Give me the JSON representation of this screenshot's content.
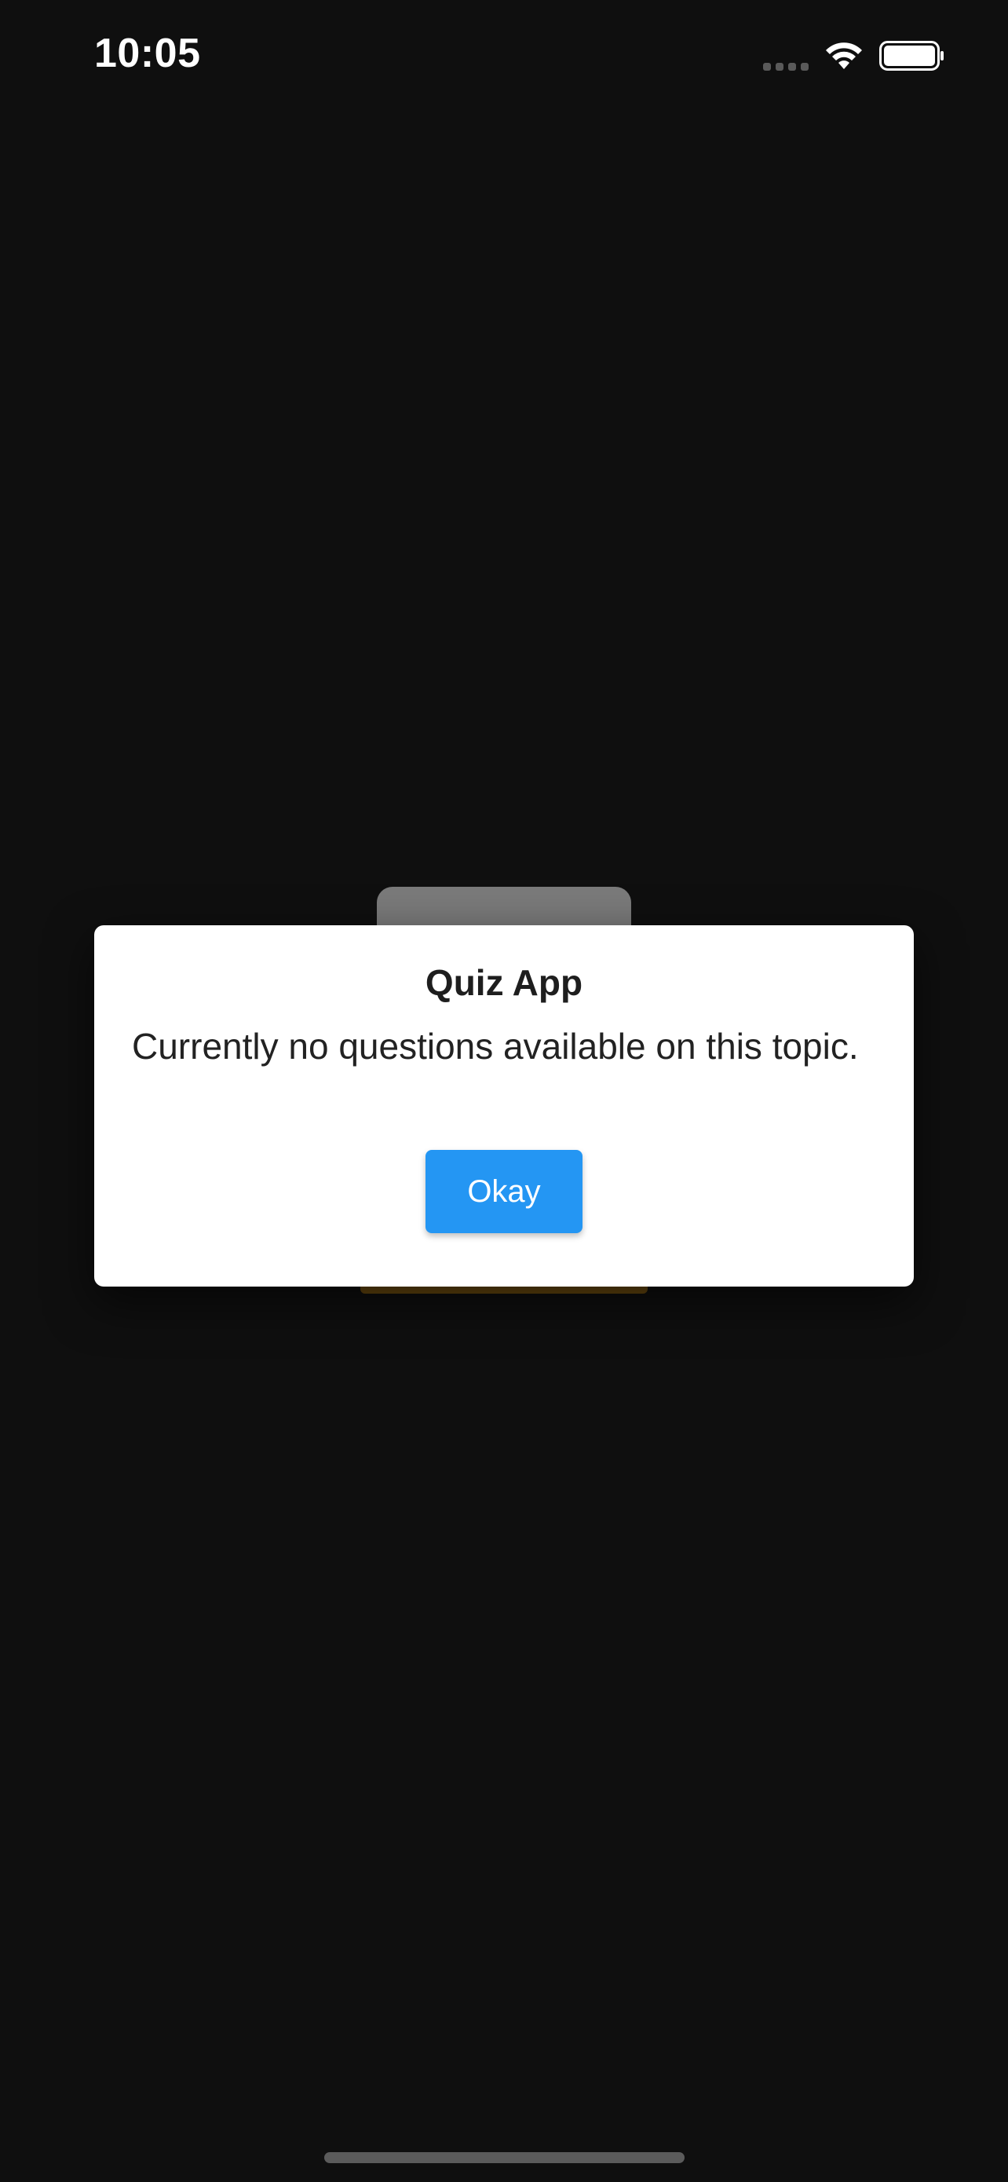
{
  "status_bar": {
    "time": "10:05",
    "icons": [
      "cellular-signal-icon",
      "wifi-icon",
      "battery-icon"
    ]
  },
  "dialog": {
    "title": "Quiz App",
    "message": "Currently no questions available on this topic.",
    "okay_label": "Okay"
  },
  "colors": {
    "background": "#0f0f0f",
    "dialog_background": "#ffffff",
    "button_accent": "#2496f3",
    "text_dark": "#222222"
  }
}
